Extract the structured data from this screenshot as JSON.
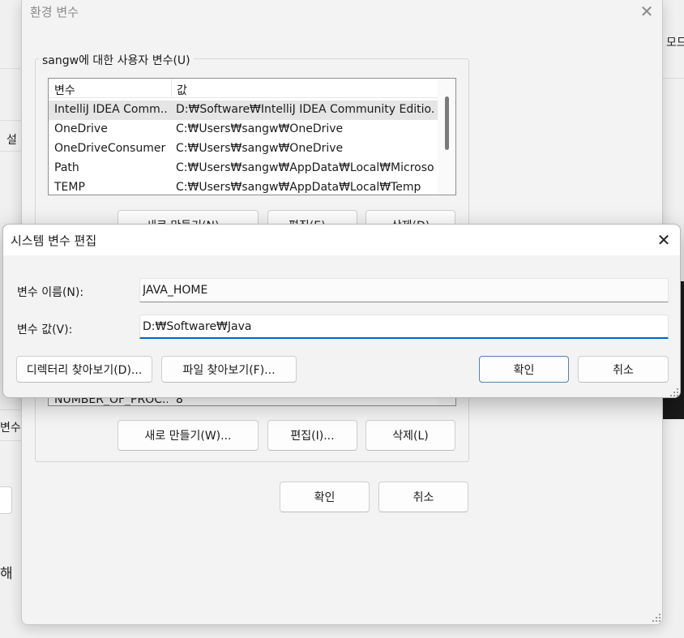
{
  "background": {
    "fragments": [
      "모드",
      "설",
      "변수",
      "해"
    ]
  },
  "env_dialog": {
    "title": "환경 변수",
    "close_glyph": "✕",
    "user_vars": {
      "group_label": "sangw에 대한 사용자 변수(U)",
      "columns": [
        "변수",
        "값"
      ],
      "rows": [
        {
          "name": "IntelliJ IDEA Comm...",
          "value": "D:₩Software₩IntelliJ IDEA Community Editio...",
          "selected": true
        },
        {
          "name": "OneDrive",
          "value": "C:₩Users₩sangw₩OneDrive",
          "selected": false
        },
        {
          "name": "OneDriveConsumer",
          "value": "C:₩Users₩sangw₩OneDrive",
          "selected": false
        },
        {
          "name": "Path",
          "value": "C:₩Users₩sangw₩AppData₩Local₩Microsoft...",
          "selected": false
        },
        {
          "name": "TEMP",
          "value": "C:₩Users₩sangw₩AppData₩Local₩Temp",
          "selected": false
        }
      ],
      "buttons": {
        "new": "새로 만들기(N)...",
        "edit": "편집(E)...",
        "delete": "삭제(D)"
      }
    },
    "system_vars": {
      "visible_row": {
        "name": "NUMBER_OF_PROC...",
        "value": "8"
      },
      "buttons": {
        "new": "새로 만들기(W)...",
        "edit": "편집(I)...",
        "delete": "삭제(L)"
      }
    },
    "ok": "확인",
    "cancel": "취소"
  },
  "edit_dialog": {
    "title": "시스템 변수 편집",
    "close_glyph": "✕",
    "name_label": "변수 이름(N):",
    "name_value": "JAVA_HOME",
    "value_label": "변수 값(V):",
    "value_value": "D:₩Software₩Java",
    "browse_dir": "디렉터리 찾아보기(D)...",
    "browse_file": "파일 찾아보기(F)...",
    "ok": "확인",
    "cancel": "취소"
  }
}
